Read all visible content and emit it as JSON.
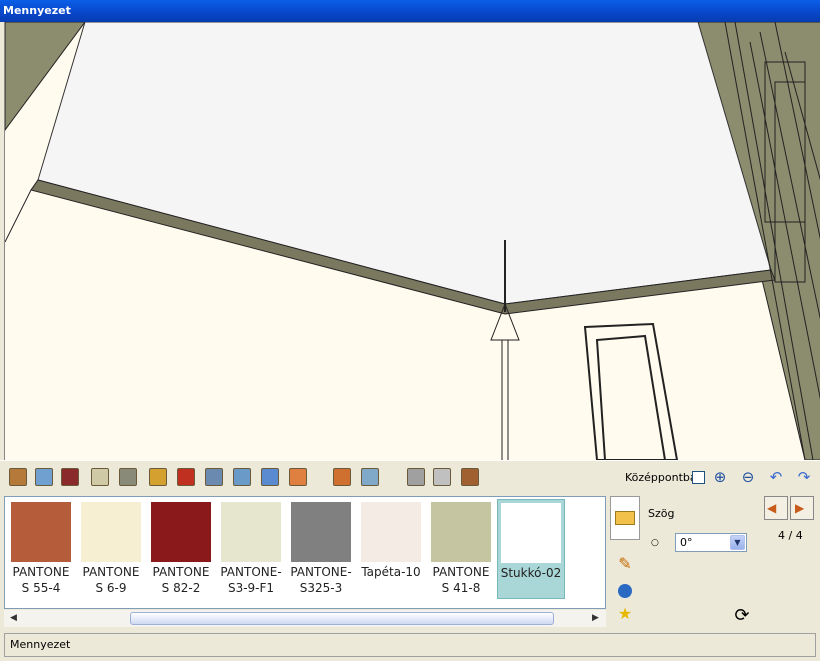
{
  "window": {
    "title": "Mennyezet"
  },
  "toolbar": {
    "tools": [
      "door-icon",
      "window-icon",
      "wardrobe-icon",
      "cabinet-icon",
      "shelf-icon",
      "ceiling-lamp-icon",
      "wall-lamp-icon",
      "picture-icon",
      "floor-plan-icon",
      "floor-icon",
      "wall-icon",
      "brick-wall-icon",
      "tile-wall-icon",
      "radiator-icon",
      "toilet-icon",
      "door-frame-icon"
    ],
    "center_label": "Középpontba",
    "right_tools": [
      "zoom-in-icon",
      "zoom-out-icon",
      "undo-icon",
      "redo-icon"
    ]
  },
  "materials": [
    {
      "label": "PANTONE S 55-4",
      "color": "#b55d3a"
    },
    {
      "label": "PANTONE S 6-9",
      "color": "#f6efd2"
    },
    {
      "label": "PANTONE S 82-2",
      "color": "#8a191b"
    },
    {
      "label": "PANTONE-S3-9-F1",
      "color": "#e6e6cf"
    },
    {
      "label": "PANTONE-S325-3",
      "color": "#808080"
    },
    {
      "label": "Tapéta-10",
      "color": "#f4ebe4"
    },
    {
      "label": "PANTONE S 41-8",
      "color": "#c6c5a1"
    },
    {
      "label": "Stukkó-02",
      "color": "#ffffff",
      "selected": true
    }
  ],
  "side_buttons": [
    "folder-icon",
    "pencil-icon",
    "globe-icon",
    "star-icon"
  ],
  "angle": {
    "label": "Szög",
    "value": "0°"
  },
  "pager": {
    "page": "4 / 4"
  },
  "status": {
    "text": "Mennyezet"
  }
}
